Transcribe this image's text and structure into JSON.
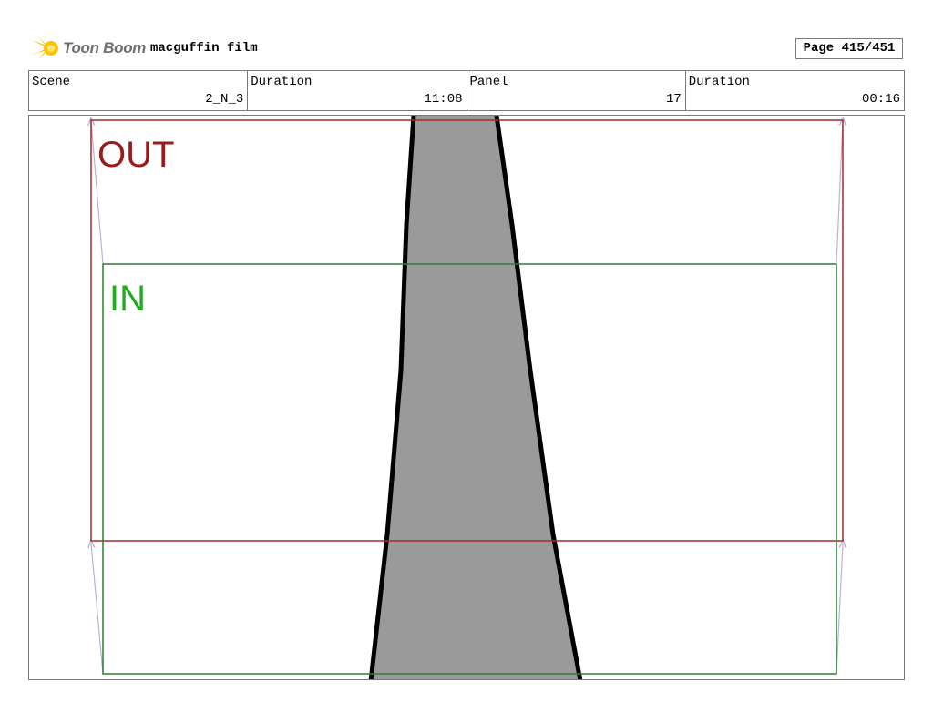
{
  "header": {
    "brand": "Toon Boom",
    "project_title": "macguffin film",
    "page_label": "Page 415/451"
  },
  "info": [
    {
      "label": "Scene",
      "value": "2_N_3"
    },
    {
      "label": "Duration",
      "value": "11:08"
    },
    {
      "label": "Panel",
      "value": "17"
    },
    {
      "label": "Duration",
      "value": "00:16"
    }
  ],
  "panel": {
    "out_label": "OUT",
    "in_label": "IN",
    "colors": {
      "out_frame": "#a52a2a",
      "in_frame": "#2e7d32",
      "in_text": "#22aa22",
      "out_text": "#9b1b1b",
      "shape_fill": "#9a9a9a",
      "motion_arrow": "#b9b2d6"
    }
  }
}
